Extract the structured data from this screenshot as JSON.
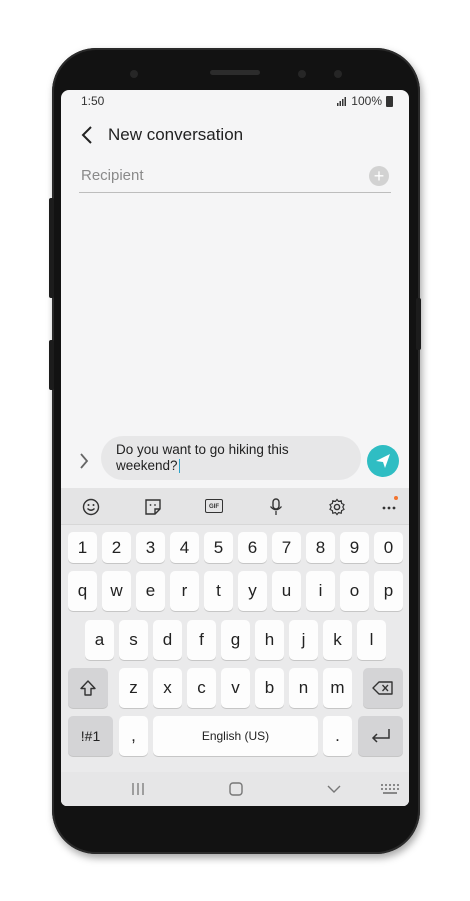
{
  "status_bar": {
    "time": "1:50",
    "battery": "100%"
  },
  "header": {
    "title": "New conversation"
  },
  "recipient": {
    "placeholder": "Recipient"
  },
  "composer": {
    "message": "Do you want to go hiking this weekend?"
  },
  "keyboard": {
    "number_row": [
      "1",
      "2",
      "3",
      "4",
      "5",
      "6",
      "7",
      "8",
      "9",
      "0"
    ],
    "row1": [
      "q",
      "w",
      "e",
      "r",
      "t",
      "y",
      "u",
      "i",
      "o",
      "p"
    ],
    "row2": [
      "a",
      "s",
      "d",
      "f",
      "g",
      "h",
      "j",
      "k",
      "l"
    ],
    "row3": [
      "z",
      "x",
      "c",
      "v",
      "b",
      "n",
      "m"
    ],
    "symbols_key": "!#1",
    "comma_key": ",",
    "space_label": "English (US)",
    "period_key": ".",
    "toolbar": {
      "gif_label": "GIF"
    }
  },
  "colors": {
    "accent": "#2fbdc3",
    "screen_bg": "#f5f5f6",
    "keyboard_bg": "#eaeaeb",
    "badge": "#f2742f"
  },
  "icons": [
    "back-arrow-icon",
    "add-recipient-icon",
    "expand-icon",
    "send-icon",
    "emoji-icon",
    "sticker-icon",
    "gif-icon",
    "microphone-icon",
    "settings-icon",
    "more-icon",
    "shift-icon",
    "backspace-icon",
    "enter-icon",
    "recents-icon",
    "home-icon",
    "back-nav-icon",
    "keyboard-icon"
  ]
}
